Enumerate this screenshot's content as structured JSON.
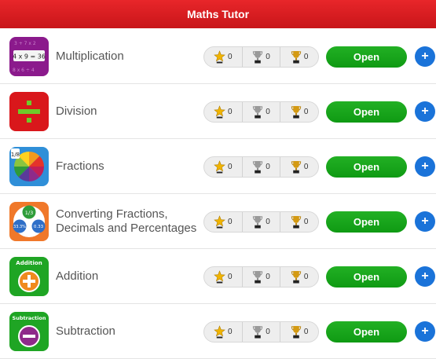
{
  "app": {
    "title": "Maths Tutor"
  },
  "colors": {
    "header": "#d91a1e",
    "open_button": "#16a418",
    "plus_button": "#1a73d9"
  },
  "topics": [
    {
      "label": "Multiplication",
      "icon": "multiplication-icon",
      "icon_text": "4 x 9 = 36",
      "star": "0",
      "silver": "0",
      "gold": "0",
      "open_label": "Open",
      "plus_label": "+"
    },
    {
      "label": "Division",
      "icon": "division-icon",
      "star": "0",
      "silver": "0",
      "gold": "0",
      "open_label": "Open",
      "plus_label": "+"
    },
    {
      "label": "Fractions",
      "icon": "fractions-icon",
      "icon_text": "1/8",
      "star": "0",
      "silver": "0",
      "gold": "0",
      "open_label": "Open",
      "plus_label": "+"
    },
    {
      "label": "Converting Fractions, Decimals and Percentages",
      "icon": "converting-icon",
      "icon_text_a": "1/3",
      "icon_text_b": "33.3%",
      "icon_text_c": "0.33",
      "star": "0",
      "silver": "0",
      "gold": "0",
      "open_label": "Open",
      "plus_label": "+"
    },
    {
      "label": "Addition",
      "icon": "addition-icon",
      "icon_text": "Addition",
      "star": "0",
      "silver": "0",
      "gold": "0",
      "open_label": "Open",
      "plus_label": "+"
    },
    {
      "label": "Subtraction",
      "icon": "subtraction-icon",
      "icon_text": "Subtraction",
      "star": "0",
      "silver": "0",
      "gold": "0",
      "open_label": "Open",
      "plus_label": "+"
    }
  ]
}
